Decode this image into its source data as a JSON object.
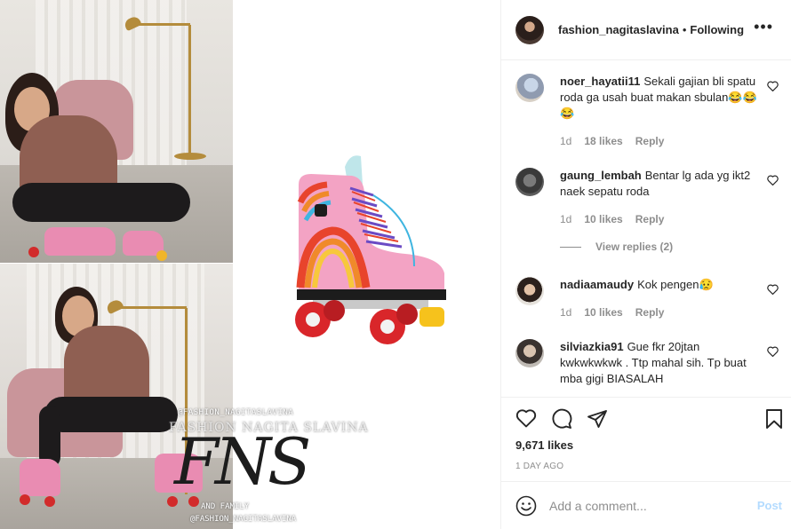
{
  "post": {
    "owner": "fashion_nagitaslavina",
    "separator": "•",
    "follow_status": "Following",
    "more_icon": "more-horizontal-icon"
  },
  "media": {
    "watermark_handle_top": "@FASHION_NAGITASLAVINA",
    "watermark_brand": "FASHION NAGITA SLAVINA",
    "watermark_logo": "FNS",
    "watermark_sub": "AND FAMILY",
    "watermark_handle_bottom": "@FASHION_NAGITASLAVINA"
  },
  "comments": [
    {
      "user": "noer_hayatii11",
      "text": "Sekali gajian bli spatu roda ga usah buat makan sbulan😂😂😂",
      "age": "1d",
      "likes": "18 likes",
      "reply": "Reply"
    },
    {
      "user": "gaung_lembah",
      "text": "Bentar lg ada yg ikt2 naek sepatu roda",
      "age": "1d",
      "likes": "10 likes",
      "reply": "Reply"
    },
    {
      "user": "nadiaamaudy",
      "text": "Kok pengen😥",
      "age": "1d",
      "likes": "10 likes",
      "reply": "Reply"
    },
    {
      "user": "silviazkia91",
      "text": "Gue fkr 20jtan kwkwkwkwk . Ttp mahal sih. Tp buat mba gigi BIASALAH"
    }
  ],
  "view_replies": "View replies (2)",
  "actions": {
    "likes": "9,671 likes",
    "time": "1 day ago"
  },
  "comment_box": {
    "placeholder": "Add a comment...",
    "post_label": "Post"
  }
}
